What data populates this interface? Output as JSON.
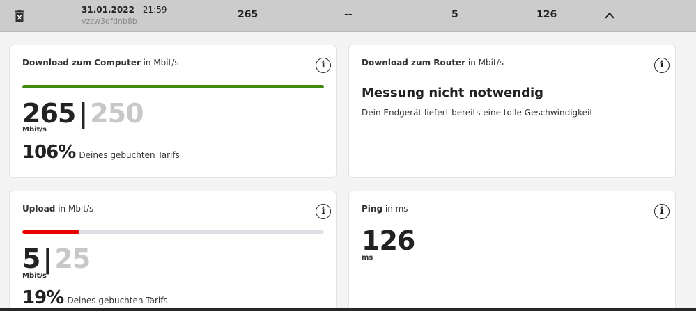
{
  "header": {
    "date": "31.01.2022",
    "time": " - 21:59",
    "id": "vzzw3dfdnb8b",
    "download": "265",
    "router": "--",
    "upload": "5",
    "ping": "126"
  },
  "download_computer": {
    "title_bold": "Download zum Computer",
    "title_unit": " in Mbit/s",
    "measured": "265",
    "separator": "|",
    "booked": "250",
    "unit": "Mbit/s",
    "percent": "106%",
    "percent_text": "Deines gebuchten Tarifs",
    "progress": 1.0,
    "bar_color": "#428a0b"
  },
  "download_router": {
    "title_bold": "Download zum Router",
    "title_unit": " in Mbit/s",
    "headline": "Messung nicht notwendig",
    "subline": "Dein Endgerät liefert bereits eine tolle Geschwindigkeit"
  },
  "upload": {
    "title_bold": "Upload",
    "title_unit": " in Mbit/s",
    "measured": "5",
    "separator": "|",
    "booked": "25",
    "unit": "Mbit/s",
    "percent": "19%",
    "percent_text": "Deines gebuchten Tarifs",
    "progress": 0.19,
    "bar_color": "#e60000"
  },
  "ping": {
    "title_bold": "Ping",
    "title_unit": " in ms",
    "value": "126",
    "unit": "ms"
  },
  "icons": {
    "info": "i"
  }
}
